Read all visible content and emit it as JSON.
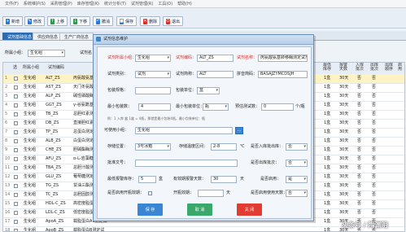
{
  "menubar": {
    "items": [
      "文件(F)",
      "系统维护(S)",
      "采购管理(P)",
      "库存管理(K)",
      "统计分析(T)",
      "试剂管理(R)",
      "工具(O)",
      "帮助(H)"
    ]
  },
  "toolbar": {
    "buttons": [
      {
        "label": "新增",
        "color": "#2a7ad6",
        "glyph": "+"
      },
      {
        "label": "修改",
        "color": "#2a7ad6",
        "glyph": "✎"
      },
      {
        "label": "上移",
        "color": "#2a9b4b",
        "glyph": "↑"
      },
      {
        "label": "下移",
        "color": "#2a9b4b",
        "glyph": "↓"
      },
      {
        "label": "撤消",
        "color": "#2a7ad6",
        "glyph": "↶"
      },
      {
        "label": "保存",
        "color": "#2a7ad6",
        "glyph": "■"
      },
      {
        "label": "删除",
        "color": "#d9302b",
        "glyph": "✕"
      },
      {
        "label": "退出",
        "color": "#d9302b",
        "glyph": "⏻"
      }
    ]
  },
  "tabs": [
    "试剂基础信息",
    "供应商信息",
    "生产厂商信息"
  ],
  "filter": {
    "group_label": "所属小组：",
    "group_value": "生化组",
    "reagent_label": "试剂名"
  },
  "grid": {
    "left_headers": [
      "选",
      "所属小组",
      "试剂编码"
    ],
    "right_headers": [
      "最低\n库存",
      "报警\n天数",
      "入库\n批次",
      "出库\n批次",
      "出库\n顺序",
      "启\n用"
    ],
    "rows": [
      {
        "group": "生化组",
        "code": "ALT_ZS",
        "name": "丙氨酸氨基转移酶",
        "min": "1盒",
        "days": "30天",
        "in": "否",
        "out": "否",
        "sel": true
      },
      {
        "group": "生化组",
        "code": "AST_ZS",
        "name": "天门冬氨酸氨基转",
        "min": "1盒",
        "days": "30天",
        "in": "否",
        "out": "否",
        "sel": false
      },
      {
        "group": "生化组",
        "code": "ALP_ZS",
        "name": "碱性磷酸酶测定试",
        "min": "1盒",
        "days": "30天",
        "in": "否",
        "out": "否",
        "sel": false
      },
      {
        "group": "生化组",
        "code": "GGT_ZS",
        "name": "γ-谷氨酰基转移酶",
        "min": "1盒",
        "days": "30天",
        "in": "否",
        "out": "否",
        "sel": false
      },
      {
        "group": "生化组",
        "code": "TB_ZS",
        "name": "总胆红素测定试剂",
        "min": "1盒",
        "days": "30天",
        "in": "否",
        "out": "否",
        "sel": false
      },
      {
        "group": "生化组",
        "code": "DB_ZS",
        "name": "直接胆红素测定试",
        "min": "1盒",
        "days": "30天",
        "in": "否",
        "out": "否",
        "sel": false
      },
      {
        "group": "生化组",
        "code": "TP_ZS",
        "name": "总蛋白测定试剂盒",
        "min": "1盒",
        "days": "30天",
        "in": "否",
        "out": "否",
        "sel": false
      },
      {
        "group": "生化组",
        "code": "ALB_ZS",
        "name": "白蛋白测定试剂盒",
        "min": "1盒",
        "days": "30天",
        "in": "否",
        "out": "否",
        "sel": false
      },
      {
        "group": "生化组",
        "code": "CHE_ZS",
        "name": "胆碱酯酶测定试剂",
        "min": "1盒",
        "days": "30天",
        "in": "否",
        "out": "否",
        "sel": false
      },
      {
        "group": "生化组",
        "code": "AFU_ZS",
        "name": "α-L-岩藻糖苷酶测",
        "min": "1盒",
        "days": "30天",
        "in": "否",
        "out": "否",
        "sel": false
      },
      {
        "group": "生化组",
        "code": "TBA_ZS",
        "name": "总胆汁酸测定试剂",
        "min": "1盒",
        "days": "30天",
        "in": "否",
        "out": "否",
        "sel": false
      },
      {
        "group": "生化组",
        "code": "GLU_ZS",
        "name": "葡萄糖测定试剂盒",
        "min": "1盒",
        "days": "30天",
        "in": "否",
        "out": "否",
        "sel": false
      },
      {
        "group": "生化组",
        "code": "TG_ZS",
        "name": "甘油三酯测定试剂",
        "min": "1盒",
        "days": "30天",
        "in": "否",
        "out": "否",
        "sel": false
      },
      {
        "group": "生化组",
        "code": "TC_ZS",
        "name": "总胆固醇测定试剂",
        "min": "1盒",
        "days": "30天",
        "in": "否",
        "out": "否",
        "sel": false
      },
      {
        "group": "生化组",
        "code": "HDL-C_ZS",
        "name": "高密度脂蛋白胆固",
        "min": "1盒",
        "days": "30天",
        "in": "否",
        "out": "否",
        "sel": false
      },
      {
        "group": "生化组",
        "code": "LDL-C_ZS",
        "name": "低密度脂蛋白胆固",
        "min": "1盒",
        "days": "30天",
        "in": "否",
        "out": "否",
        "sel": false
      },
      {
        "group": "生化组",
        "code": "ApoA_ZS",
        "name": "载脂蛋白A1测定试",
        "min": "1盒",
        "days": "30天",
        "in": "否",
        "out": "否",
        "sel": false
      },
      {
        "group": "生化组",
        "code": "ApoB_ZS",
        "name": "载脂蛋白B测定试",
        "min": "1盒",
        "days": "30天",
        "in": "否",
        "out": "否",
        "sel": false
      }
    ]
  },
  "dialog": {
    "title": "试剂信息维护",
    "group_label": "试剂所属小组：",
    "group_value": "生化组",
    "code_label": "试剂编码：",
    "code_value": "ALT_ZS",
    "name_label": "试剂名称：",
    "name_value": "丙氨酸氨基转移酶测定试剂盒",
    "type_label": "试剂类别：",
    "type_value": "试剂",
    "short_label": "试剂简称：",
    "short_value": "ALT",
    "pinyin_label": "拼音简码：",
    "pinyin_value": "BASAJZYMCDSJH",
    "spec_label": "包装规格：",
    "spec_value": "",
    "pack_label": "包装单位：",
    "pack_value": "盒",
    "minpack_label": "最小包装数：",
    "minpack_value": "4",
    "minunit_label": "最小包装单位：",
    "minunit_value": "瓶",
    "test_label": "预估测试数：",
    "test_value": "0",
    "test_unit": "个/瓶",
    "hint_text": "例：1 入库 盒 1盒 = 4瓶，那就是最小包装4瓶，最小包装单位：瓶",
    "usable_label": "可使用小组：",
    "usable_value": "生化组",
    "store_label": "存储位置：",
    "store_value": "3号冰箱",
    "temp_label": "存储温度区间：",
    "temp_value": "2-8",
    "temp_unit": "℃",
    "in_batch_label": "是否入库批出库：",
    "in_batch_value": "否",
    "approve_label": "批准文号：",
    "approve_value": "",
    "out_batch_label": "是否出库批次：",
    "out_batch_value": "否",
    "min_stock_label": "最低报警库存：",
    "min_stock_value": "5",
    "min_stock_unit": "盒",
    "expire_label": "有效期报警天数：",
    "expire_value": "30",
    "expire_unit": "天",
    "enabled_label": "是否启用：",
    "enabled_value": "是",
    "open_check_label": "是否启用开瓶效期：",
    "open_days_label": "开瓶效期：",
    "open_days_value": "",
    "open_days_unit": "天",
    "seq_label": "是否启用使用天数：",
    "seq_value": "否",
    "save_label": "保 存",
    "cancel_label": "取 消",
    "close_label": "关 闭",
    "save_color": "#3a86d4",
    "cancel_color": "#3aa86a",
    "close_color": "#e23b32"
  },
  "watermark": "头条号 / 陶渊明"
}
